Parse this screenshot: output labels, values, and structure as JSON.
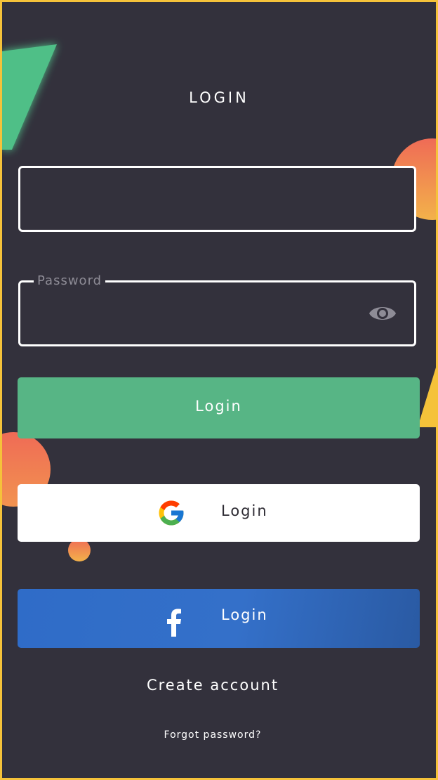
{
  "screen": {
    "title": "LOGIN"
  },
  "form": {
    "email": {
      "value": "",
      "label": ""
    },
    "password": {
      "label": "Password",
      "value": ""
    },
    "login_button": "Login"
  },
  "social": {
    "google_label": "Login",
    "facebook_label": "Login"
  },
  "links": {
    "create_account": "Create account",
    "forgot_password": "Forgot password?"
  },
  "icons": {
    "password_toggle": "eye-icon",
    "google": "google-icon",
    "facebook": "facebook-icon"
  },
  "colors": {
    "background": "#33313c",
    "frame": "#f5c23a",
    "login_button": "#57b585",
    "facebook_button": "#2f6cc8",
    "google_button": "#ffffff",
    "accent_green": "#4fbf87",
    "accent_orange": "#ef6b56"
  }
}
